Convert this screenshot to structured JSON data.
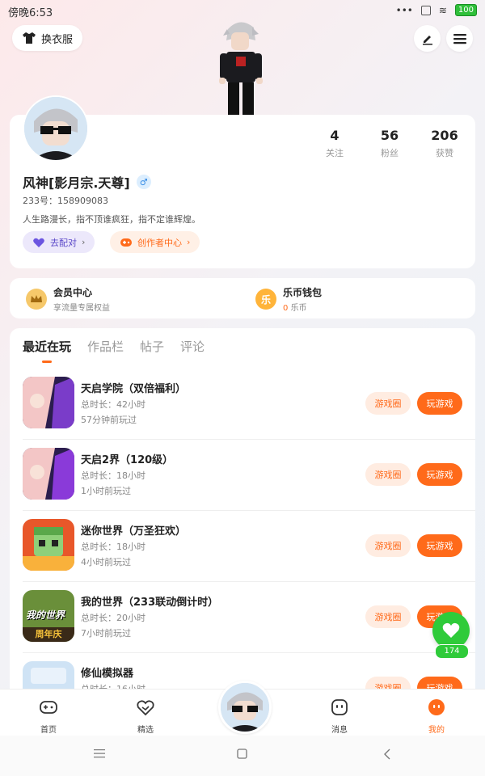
{
  "status_bar": {
    "time": "傍晚6:53",
    "dots": "•••",
    "wifi": "≋",
    "battery": "100"
  },
  "header": {
    "outfit_label": "换衣服"
  },
  "profile": {
    "stats": [
      {
        "value": "4",
        "label": "关注"
      },
      {
        "value": "56",
        "label": "粉丝"
      },
      {
        "value": "206",
        "label": "获赞"
      }
    ],
    "name": "风神[影月宗.天尊]",
    "gender_symbol": "♂",
    "id_label": "233号：158909083",
    "bio": "人生路漫长，指不顶谁疯狂，指不定谁辉煌。",
    "pair_label": "去配对",
    "creator_label": "创作者中心",
    "chevron": "›"
  },
  "vip": {
    "member_title": "会员中心",
    "member_sub": "享流量专属权益",
    "wallet_title": "乐币钱包",
    "wallet_amount": "0",
    "wallet_unit": "乐币",
    "wallet_coin_char": "乐"
  },
  "tabs": [
    "最近在玩",
    "作品栏",
    "帖子",
    "评论"
  ],
  "games": [
    {
      "name": "天启学院（双倍福利）",
      "duration": "总时长：42小时",
      "ago": "57分钟前玩过",
      "btn_circle": "游戏圈",
      "btn_play": "玩游戏"
    },
    {
      "name": "天启2界（120级）",
      "duration": "总时长：18小时",
      "ago": "1小时前玩过",
      "btn_circle": "游戏圈",
      "btn_play": "玩游戏"
    },
    {
      "name": "迷你世界（万圣狂欢）",
      "duration": "总时长：18小时",
      "ago": "4小时前玩过",
      "btn_circle": "游戏圈",
      "btn_play": "玩游戏"
    },
    {
      "name": "我的世界（233联动倒计时）",
      "duration": "总时长：20小时",
      "ago": "7小时前玩过",
      "btn_circle": "游戏圈",
      "btn_play": "玩游戏",
      "icon_text_top": "我的世界",
      "icon_text_bottom": "周年庆"
    },
    {
      "name": "修仙模拟器",
      "duration": "总时长：16小时",
      "ago": "",
      "btn_circle": "游戏圈",
      "btn_play": "玩游戏"
    }
  ],
  "heart": {
    "count": "174"
  },
  "nav": {
    "home": "首页",
    "featured": "精选",
    "messages": "消息",
    "mine": "我的"
  },
  "colors": {
    "accent": "#ff6a1a",
    "heart": "#2fcb3a"
  }
}
